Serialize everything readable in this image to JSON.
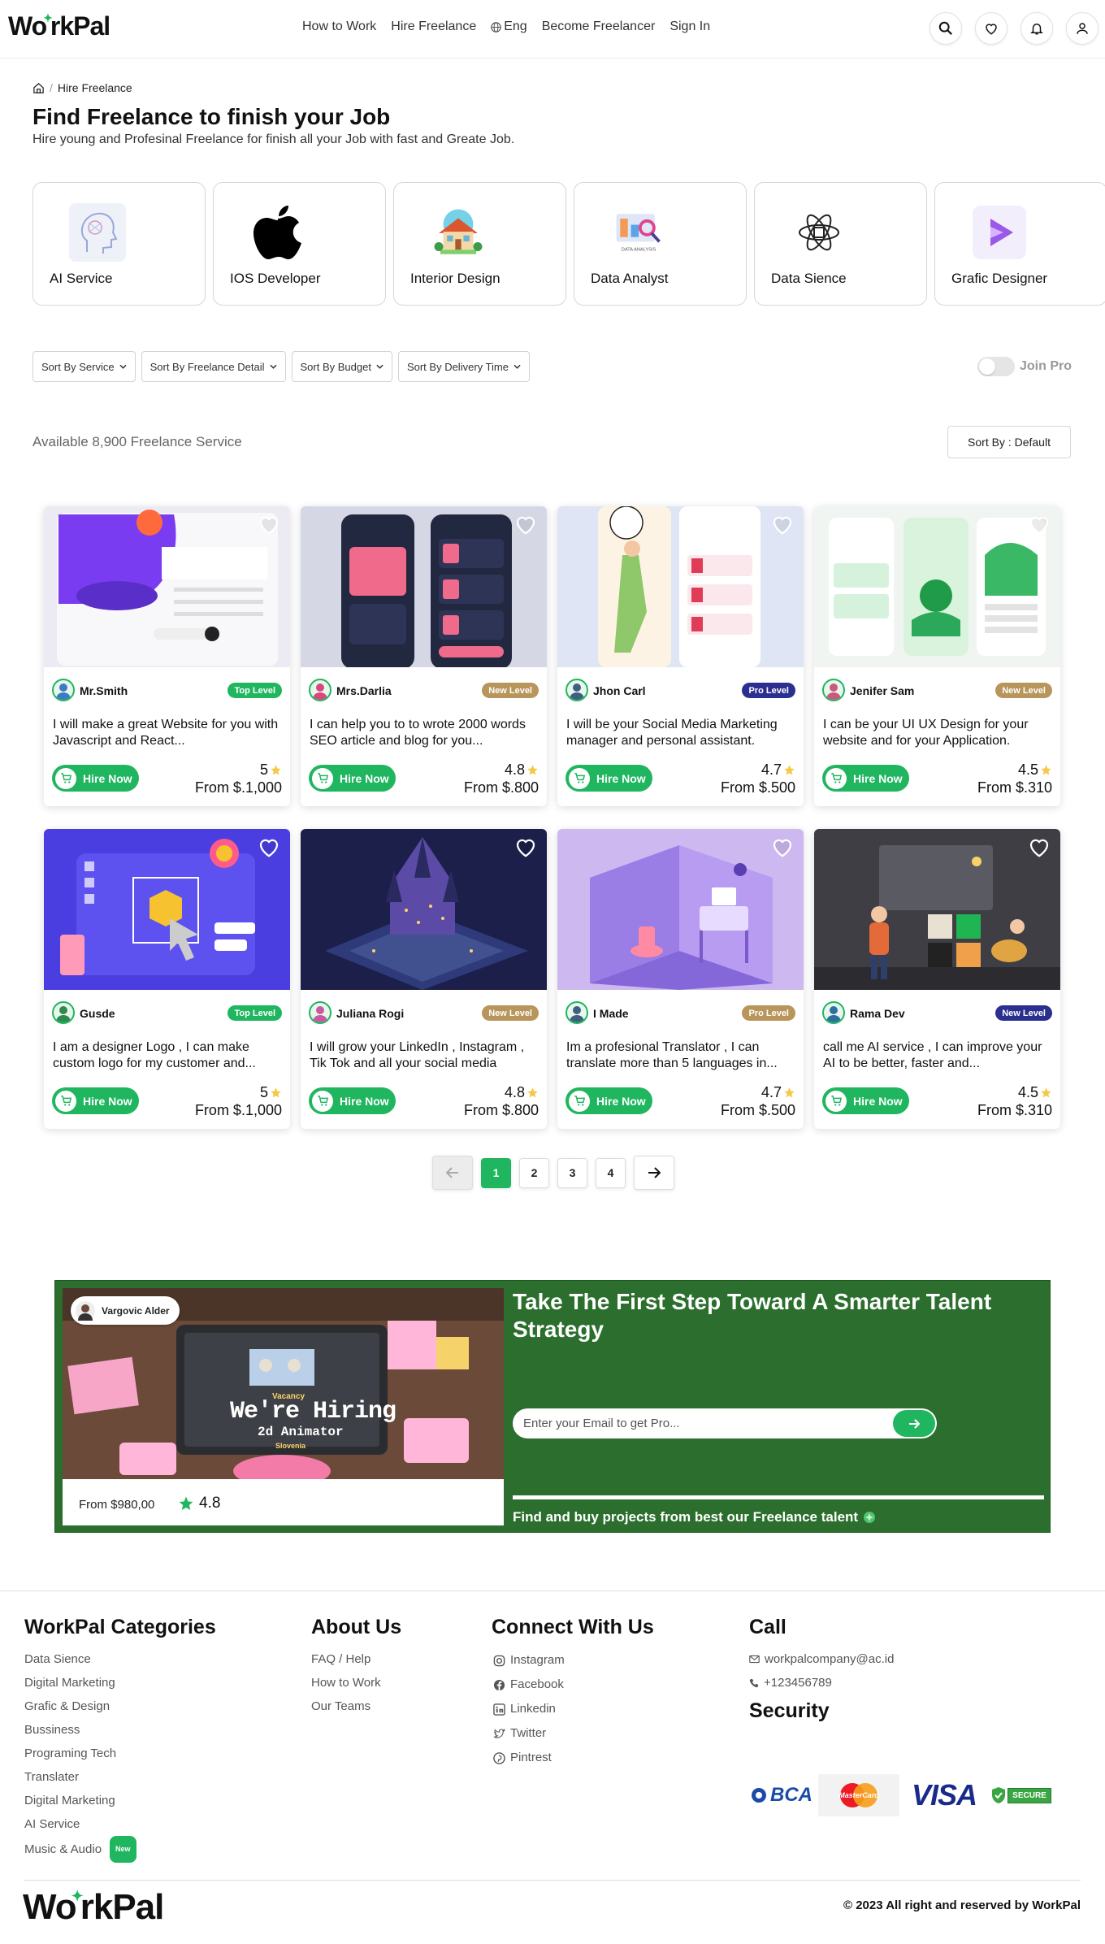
{
  "nav": {
    "logo": "WorkPal",
    "links": [
      "How to Work",
      "Hire Freelance",
      "Eng",
      "Become Freelancer",
      "Sign In"
    ]
  },
  "breadcrumb": {
    "current": "Hire Freelance"
  },
  "hero": {
    "title": "Find Freelance to finish your Job",
    "subtitle": "Hire young and Profesinal Freelance for finish all your Job with fast and Greate Job."
  },
  "categories": [
    "AI Service",
    "IOS Developer",
    "Interior Design",
    "Data Analyst",
    "Data Sience",
    "Grafic Designer"
  ],
  "filters": [
    "Sort By Service",
    "Sort By Freelance Detail",
    "Sort By Budget",
    "Sort By Delivery Time"
  ],
  "join_pro": "Join Pro",
  "available": "Available 8,900 Freelance Service",
  "sort_default": "Sort By : Default",
  "hire_label": "Hire Now",
  "cards": [
    {
      "seller": "Mr.Smith",
      "level": "Top Level",
      "level_color": "#20b65f",
      "desc": "I will make a great Website for you with Javascript and React...",
      "rating": "5",
      "price": "From $.1,000"
    },
    {
      "seller": "Mrs.Darlia",
      "level": "New Level",
      "level_color": "#b8955a",
      "desc": "I can help you to to wrote 2000 words SEO article and blog for you...",
      "rating": "4.8",
      "price": "From $.800"
    },
    {
      "seller": "Jhon Carl",
      "level": "Pro Level",
      "level_color": "#2b2f8f",
      "desc": "I will be your Social Media Marketing manager and personal assistant.",
      "rating": "4.7",
      "price": "From $.500"
    },
    {
      "seller": "Jenifer Sam",
      "level": "New Level",
      "level_color": "#b8955a",
      "desc": "I can be your UI UX Design for your website and for your Application.",
      "rating": "4.5",
      "price": "From $.310"
    },
    {
      "seller": "Gusde",
      "level": "Top Level",
      "level_color": "#20b65f",
      "desc": "I am a designer Logo , I can make custom logo for my customer and...",
      "rating": "5",
      "price": "From $.1,000"
    },
    {
      "seller": "Juliana Rogi",
      "level": "New Level",
      "level_color": "#b8955a",
      "desc": "I will grow your LinkedIn , Instagram , Tik Tok and all your social media",
      "rating": "4.8",
      "price": "From $.800"
    },
    {
      "seller": "I Made",
      "level": "Pro Level",
      "level_color": "#b8955a",
      "desc": "Im a profesional Translator , I can translate more than 5 languages in...",
      "rating": "4.7",
      "price": "From $.500"
    },
    {
      "seller": "Rama Dev",
      "level": "New Level",
      "level_color": "#2b2f8f",
      "desc": "call me AI service , I can improve your AI to be better, faster and...",
      "rating": "4.5",
      "price": "From $.310"
    }
  ],
  "pagination": [
    "1",
    "2",
    "3",
    "4"
  ],
  "banner": {
    "name": "Vargovic Alder",
    "price": "From $980,00",
    "rating": "4.8",
    "title": "Take The First Step Toward A Smarter Talent Strategy",
    "placeholder": "Enter your Email to get Pro...",
    "footer": "Find and buy projects from best our Freelance talent",
    "image_text_1": "We're Hiring",
    "image_text_2": "2d Animator",
    "image_text_3": "Vacancy",
    "image_text_4": "Slovenia"
  },
  "footer": {
    "cat_title": "WorkPal Categories",
    "cats": [
      "Data Sience",
      "Digital Marketing",
      "Grafic & Design",
      "Bussiness",
      "Programing Tech",
      "Translater",
      "Digital Marketing",
      "AI Service",
      "Music & Audio"
    ],
    "new_badge": "New",
    "about_title": "About Us",
    "about": [
      "FAQ / Help",
      "How to Work",
      "Our Teams"
    ],
    "connect_title": "Connect With Us",
    "connect": [
      "Instagram",
      "Facebook",
      "Linkedin",
      "Twitter",
      "Pintrest"
    ],
    "call_title": "Call",
    "email": "workpalcompany@ac.id",
    "phone": "+123456789",
    "security_title": "Security",
    "payments": [
      "BCA",
      "MasterCard",
      "VISA",
      "SECURE"
    ],
    "copyright": "© 2023 All right and reserved by WorkPal"
  },
  "colors": {
    "accent": "#20b65f",
    "banner": "#2b6e2d"
  }
}
